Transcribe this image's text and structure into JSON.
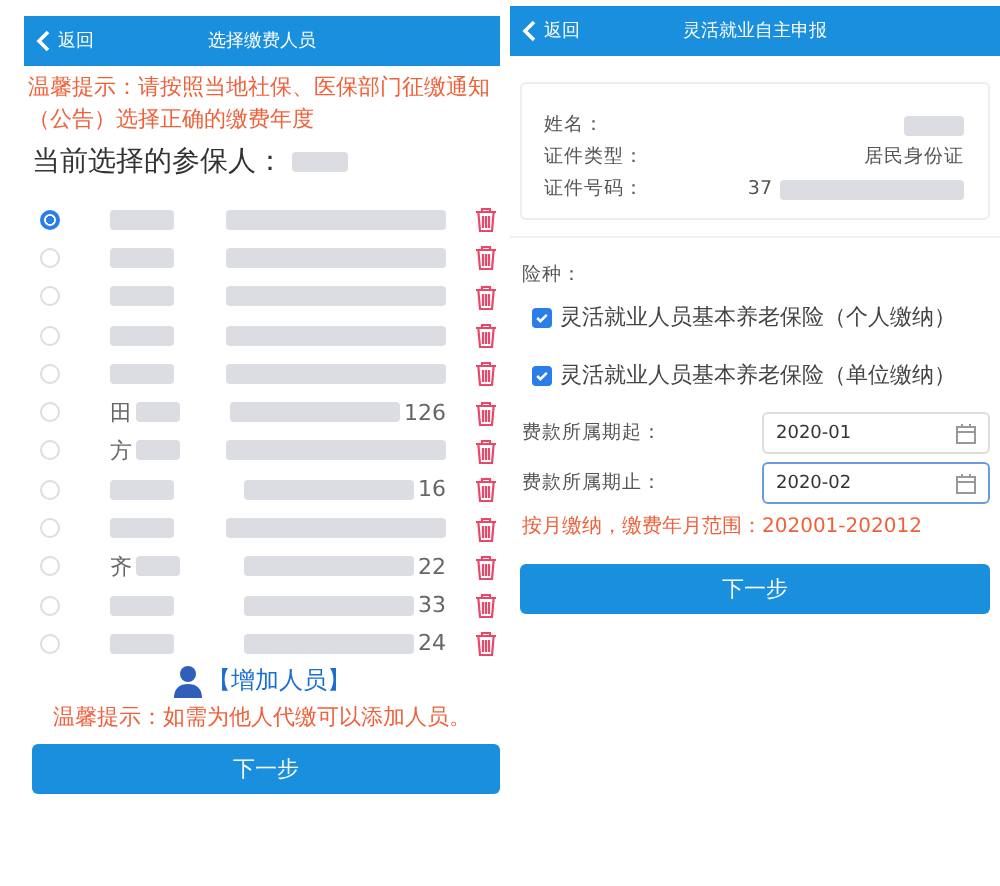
{
  "left_screen": {
    "header": {
      "back": "返回",
      "title": "选择缴费人员"
    },
    "notice": "温馨提示：请按照当地社保、医保部门征缴通知（公告）选择正确的缴费年度",
    "current_label": "当前选择的参保人：",
    "people": [
      {
        "selected": true
      },
      {
        "selected": false
      },
      {
        "selected": false
      },
      {
        "selected": false
      },
      {
        "selected": false
      },
      {
        "selected": false,
        "name": "田",
        "number": "126"
      },
      {
        "selected": false,
        "name": "方"
      },
      {
        "selected": false,
        "number": "16"
      },
      {
        "selected": false
      },
      {
        "selected": false,
        "name": "齐",
        "number": "22"
      },
      {
        "selected": false,
        "number": "33"
      },
      {
        "selected": false,
        "number": "24"
      }
    ],
    "add_person": "【增加人员】",
    "tip": "温馨提示：如需为他人代缴可以添加人员。",
    "next": "下一步"
  },
  "right_screen": {
    "header": {
      "back": "返回",
      "title": "灵活就业自主申报"
    },
    "info": [
      {
        "label": "姓名："
      },
      {
        "label": "证件类型：",
        "value": "居民身份证"
      },
      {
        "label": "证件号码：",
        "value": "37"
      }
    ],
    "insurance_label": "险种：",
    "insurance": [
      {
        "label": "灵活就业人员基本养老保险（个人缴纳）",
        "checked": true
      },
      {
        "label": "灵活就业人员基本养老保险（单位缴纳）",
        "checked": true
      }
    ],
    "periods": [
      {
        "label": "费款所属期起：",
        "value": "2020-01",
        "focused": false
      },
      {
        "label": "费款所属期止：",
        "value": "2020-02",
        "focused": true
      }
    ],
    "note": "按月缴纳，缴费年月范围：202001-202012",
    "next": "下一步"
  }
}
